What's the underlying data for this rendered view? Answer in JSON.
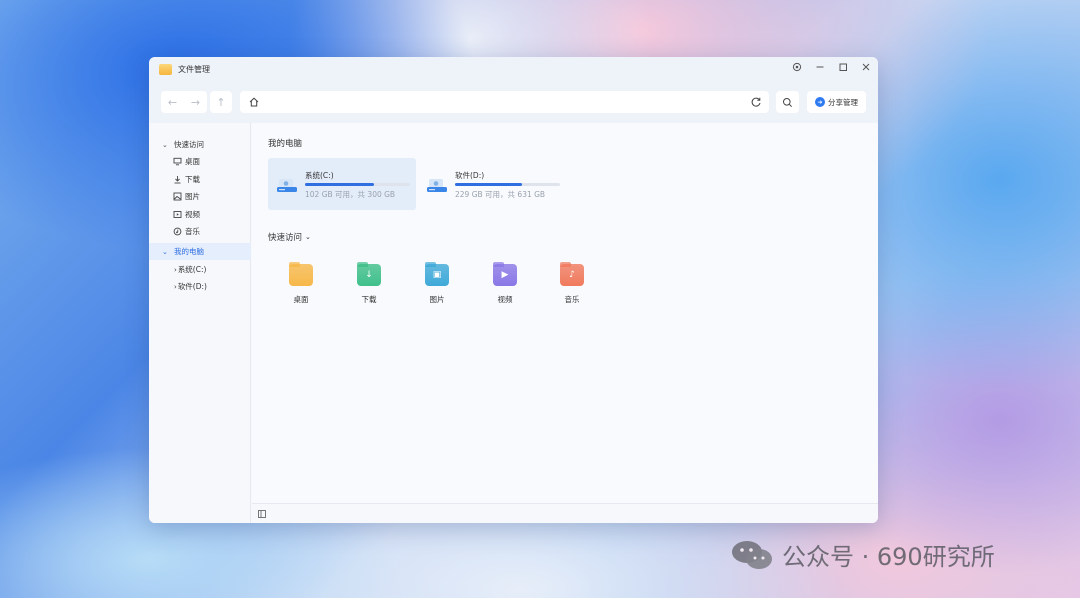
{
  "window": {
    "title": "文件管理",
    "controls": [
      "settings-icon",
      "minimize-icon",
      "maximize-icon",
      "close-icon"
    ]
  },
  "toolbar": {
    "back_icon": "←",
    "forward_icon": "→",
    "up_icon": "↑",
    "address_value": "",
    "share_label": "分享管理"
  },
  "sidebar": {
    "quick_access": {
      "label": "快速访问",
      "items": [
        {
          "label": "桌面",
          "icon": "desktop-icon"
        },
        {
          "label": "下载",
          "icon": "download-icon"
        },
        {
          "label": "图片",
          "icon": "image-icon"
        },
        {
          "label": "视频",
          "icon": "video-icon"
        },
        {
          "label": "音乐",
          "icon": "music-icon"
        }
      ]
    },
    "my_computer": {
      "label": "我的电脑",
      "drives": [
        {
          "label": "系统(C:)"
        },
        {
          "label": "软件(D:)"
        }
      ]
    }
  },
  "main": {
    "my_computer_title": "我的电脑",
    "drives": [
      {
        "name": "系统(C:)",
        "space": "102 GB 可用，共 300 GB",
        "used_fraction": 0.66
      },
      {
        "name": "软件(D:)",
        "space": "229 GB 可用，共 631 GB",
        "used_fraction": 0.64
      }
    ],
    "quick_access_title": "快速访问",
    "quick_access_items": [
      {
        "label": "桌面",
        "color": "#f7b84a",
        "glyph": ""
      },
      {
        "label": "下载",
        "color": "#3fbf8a",
        "glyph": "↓"
      },
      {
        "label": "图片",
        "color": "#3fa9d8",
        "glyph": "▣"
      },
      {
        "label": "视频",
        "color": "#8a78e6",
        "glyph": "▶"
      },
      {
        "label": "音乐",
        "color": "#f07a5e",
        "glyph": "♪"
      }
    ]
  },
  "watermark": {
    "text": "公众号 · 690研究所"
  },
  "colors": {
    "accent": "#2f6fe0",
    "selected_bg": "#e3ecf9"
  }
}
